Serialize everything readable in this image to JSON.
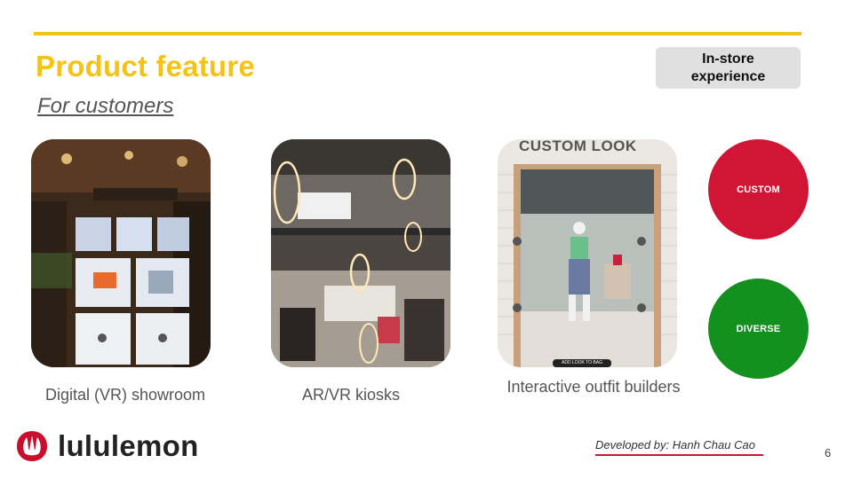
{
  "slide": {
    "title": "Product feature",
    "subtitle": "For customers",
    "tag": "In-store experience",
    "page_number": "6"
  },
  "features": [
    {
      "caption": "Digital (VR) showroom"
    },
    {
      "caption": "AR/VR kiosks"
    },
    {
      "caption": "Interactive outfit builders",
      "image_heading": "CUSTOM LOOK",
      "image_button": "ADD LOOK TO BAG"
    }
  ],
  "badges": [
    {
      "label": "CUSTOM",
      "color": "#d11535"
    },
    {
      "label": "DIVERSE",
      "color": "#13901e"
    }
  ],
  "brand": {
    "name": "lululemon",
    "logo_icon": "lululemon-logo-icon"
  },
  "footer": {
    "credit": "Developed by: Hanh Chau Cao"
  },
  "colors": {
    "accent": "#f5c216",
    "text": "#555555",
    "tag_bg": "#e0e0e0"
  }
}
